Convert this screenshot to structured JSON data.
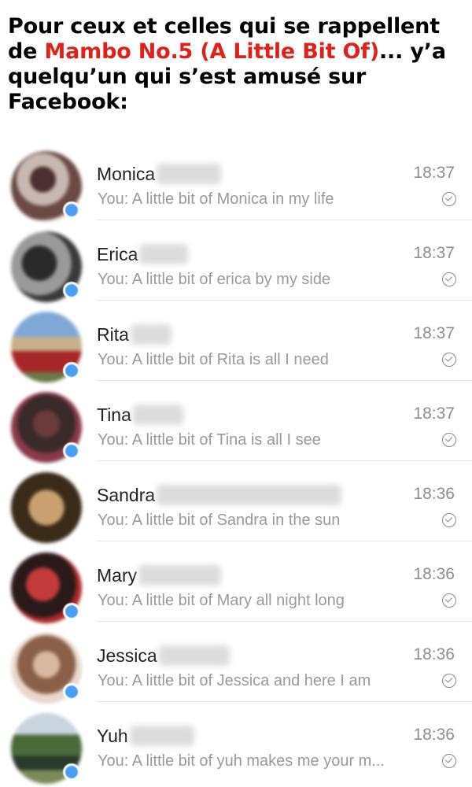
{
  "caption": {
    "line_before": "Pour ceux et celles qui se rappellent de ",
    "song": "Mambo No.5 (A Little Bit Of)",
    "line_after": "... y’a quelqu’un qui s’est amusé sur Facebook:"
  },
  "colors": {
    "accent_red": "#e0211a",
    "presence_blue": "#4a9ff0"
  },
  "conversations": [
    {
      "name": "Monica",
      "time": "18:37",
      "message": "You: A little bit of Monica in my life"
    },
    {
      "name": "Erica",
      "time": "18:37",
      "message": "You: A little bit of erica by my side"
    },
    {
      "name": "Rita",
      "time": "18:37",
      "message": "You: A little bit of Rita is all I need"
    },
    {
      "name": "Tina",
      "time": "18:37",
      "message": "You: A little bit of Tina is all I see"
    },
    {
      "name": "Sandra",
      "time": "18:36",
      "message": "You: A little bit of Sandra in the sun"
    },
    {
      "name": "Mary",
      "time": "18:36",
      "message": "You: A little bit of Mary all night long"
    },
    {
      "name": "Jessica",
      "time": "18:36",
      "message": "You: A little bit of Jessica and here I am"
    },
    {
      "name": "Yuh",
      "time": "18:36",
      "message": "You: A little bit of yuh makes me your m..."
    }
  ]
}
